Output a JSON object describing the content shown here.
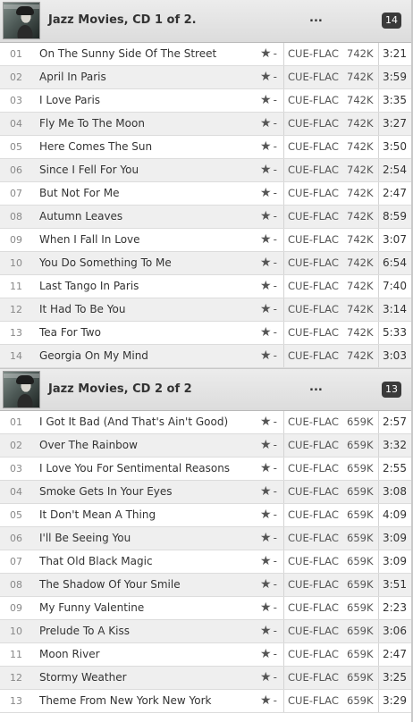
{
  "albums": [
    {
      "title": "Jazz Movies, CD 1 of 2.",
      "ellipsis": "...",
      "track_count": "14",
      "tracks": [
        {
          "num": "01",
          "title": "On The Sunny Side Of The Street",
          "star": "★",
          "rating": "-",
          "format": "CUE-FLAC",
          "size": "742K",
          "duration": "3:21"
        },
        {
          "num": "02",
          "title": "April In Paris",
          "star": "★",
          "rating": "-",
          "format": "CUE-FLAC",
          "size": "742K",
          "duration": "3:59"
        },
        {
          "num": "03",
          "title": "I Love Paris",
          "star": "★",
          "rating": "-",
          "format": "CUE-FLAC",
          "size": "742K",
          "duration": "3:35"
        },
        {
          "num": "04",
          "title": "Fly Me To The Moon",
          "star": "★",
          "rating": "-",
          "format": "CUE-FLAC",
          "size": "742K",
          "duration": "3:27"
        },
        {
          "num": "05",
          "title": "Here Comes The Sun",
          "star": "★",
          "rating": "-",
          "format": "CUE-FLAC",
          "size": "742K",
          "duration": "3:50"
        },
        {
          "num": "06",
          "title": "Since I Fell For You",
          "star": "★",
          "rating": "-",
          "format": "CUE-FLAC",
          "size": "742K",
          "duration": "2:54"
        },
        {
          "num": "07",
          "title": "But Not For Me",
          "star": "★",
          "rating": "-",
          "format": "CUE-FLAC",
          "size": "742K",
          "duration": "2:47"
        },
        {
          "num": "08",
          "title": "Autumn Leaves",
          "star": "★",
          "rating": "-",
          "format": "CUE-FLAC",
          "size": "742K",
          "duration": "8:59"
        },
        {
          "num": "09",
          "title": "When I Fall In Love",
          "star": "★",
          "rating": "-",
          "format": "CUE-FLAC",
          "size": "742K",
          "duration": "3:07"
        },
        {
          "num": "10",
          "title": "You Do Something To Me",
          "star": "★",
          "rating": "-",
          "format": "CUE-FLAC",
          "size": "742K",
          "duration": "6:54"
        },
        {
          "num": "11",
          "title": "Last Tango In Paris",
          "star": "★",
          "rating": "-",
          "format": "CUE-FLAC",
          "size": "742K",
          "duration": "7:40"
        },
        {
          "num": "12",
          "title": "It Had To Be You",
          "star": "★",
          "rating": "-",
          "format": "CUE-FLAC",
          "size": "742K",
          "duration": "3:14"
        },
        {
          "num": "13",
          "title": "Tea For Two",
          "star": "★",
          "rating": "-",
          "format": "CUE-FLAC",
          "size": "742K",
          "duration": "5:33"
        },
        {
          "num": "14",
          "title": "Georgia On My Mind",
          "star": "★",
          "rating": "-",
          "format": "CUE-FLAC",
          "size": "742K",
          "duration": "3:03"
        }
      ]
    },
    {
      "title": "Jazz Movies, CD 2 of 2",
      "ellipsis": "...",
      "track_count": "13",
      "tracks": [
        {
          "num": "01",
          "title": "I Got It Bad (And That's Ain't Good)",
          "star": "★",
          "rating": "-",
          "format": "CUE-FLAC",
          "size": "659K",
          "duration": "2:57"
        },
        {
          "num": "02",
          "title": "Over The Rainbow",
          "star": "★",
          "rating": "-",
          "format": "CUE-FLAC",
          "size": "659K",
          "duration": "3:32"
        },
        {
          "num": "03",
          "title": "I Love You For Sentimental Reasons",
          "star": "★",
          "rating": "-",
          "format": "CUE-FLAC",
          "size": "659K",
          "duration": "2:55"
        },
        {
          "num": "04",
          "title": "Smoke Gets In Your Eyes",
          "star": "★",
          "rating": "-",
          "format": "CUE-FLAC",
          "size": "659K",
          "duration": "3:08"
        },
        {
          "num": "05",
          "title": "It Don't Mean A Thing",
          "star": "★",
          "rating": "-",
          "format": "CUE-FLAC",
          "size": "659K",
          "duration": "4:09"
        },
        {
          "num": "06",
          "title": "I'll Be Seeing You",
          "star": "★",
          "rating": "-",
          "format": "CUE-FLAC",
          "size": "659K",
          "duration": "3:09"
        },
        {
          "num": "07",
          "title": "That Old Black Magic",
          "star": "★",
          "rating": "-",
          "format": "CUE-FLAC",
          "size": "659K",
          "duration": "3:09"
        },
        {
          "num": "08",
          "title": "The Shadow Of Your Smile",
          "star": "★",
          "rating": "-",
          "format": "CUE-FLAC",
          "size": "659K",
          "duration": "3:51"
        },
        {
          "num": "09",
          "title": "My Funny Valentine",
          "star": "★",
          "rating": "-",
          "format": "CUE-FLAC",
          "size": "659K",
          "duration": "2:23"
        },
        {
          "num": "10",
          "title": "Prelude To A Kiss",
          "star": "★",
          "rating": "-",
          "format": "CUE-FLAC",
          "size": "659K",
          "duration": "3:06"
        },
        {
          "num": "11",
          "title": "Moon River",
          "star": "★",
          "rating": "-",
          "format": "CUE-FLAC",
          "size": "659K",
          "duration": "2:47"
        },
        {
          "num": "12",
          "title": "Stormy Weather",
          "star": "★",
          "rating": "-",
          "format": "CUE-FLAC",
          "size": "659K",
          "duration": "3:25"
        },
        {
          "num": "13",
          "title": "Theme From New York New York",
          "star": "★",
          "rating": "-",
          "format": "CUE-FLAC",
          "size": "659K",
          "duration": "3:29"
        }
      ]
    }
  ],
  "icons": {
    "cover": "album-cover-image",
    "rating": "star-icon"
  },
  "colors": {
    "header_bg": "#dcdcdc",
    "row_alt": "#efefef",
    "badge_bg": "#3a3a3a"
  }
}
